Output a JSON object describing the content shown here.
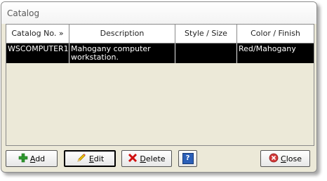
{
  "window": {
    "title": "Catalog"
  },
  "grid": {
    "columns": [
      "Catalog No. »",
      "Description",
      "Style / Size",
      "Color / Finish"
    ],
    "rows": [
      {
        "catalog_no": "WSCOMPUTER1",
        "description": "Mahogany computer workstation.",
        "style_size": "",
        "color_finish": "Red/Mahogany"
      }
    ]
  },
  "buttons": {
    "add": {
      "accel": "A",
      "rest": "dd"
    },
    "edit": {
      "accel": "E",
      "rest": "dit"
    },
    "delete": {
      "accel": "D",
      "rest": "elete"
    },
    "help": {
      "label": "?"
    },
    "close": {
      "accel": "C",
      "rest": "lose"
    }
  },
  "icons": {
    "add": "plus-icon",
    "edit": "pencil-icon",
    "delete": "red-x-icon",
    "help": "help-icon",
    "close": "close-circle-icon"
  },
  "colors": {
    "selected_row_bg": "#000000",
    "selected_row_fg": "#ffffff",
    "window_bg": "#ece9d8"
  }
}
